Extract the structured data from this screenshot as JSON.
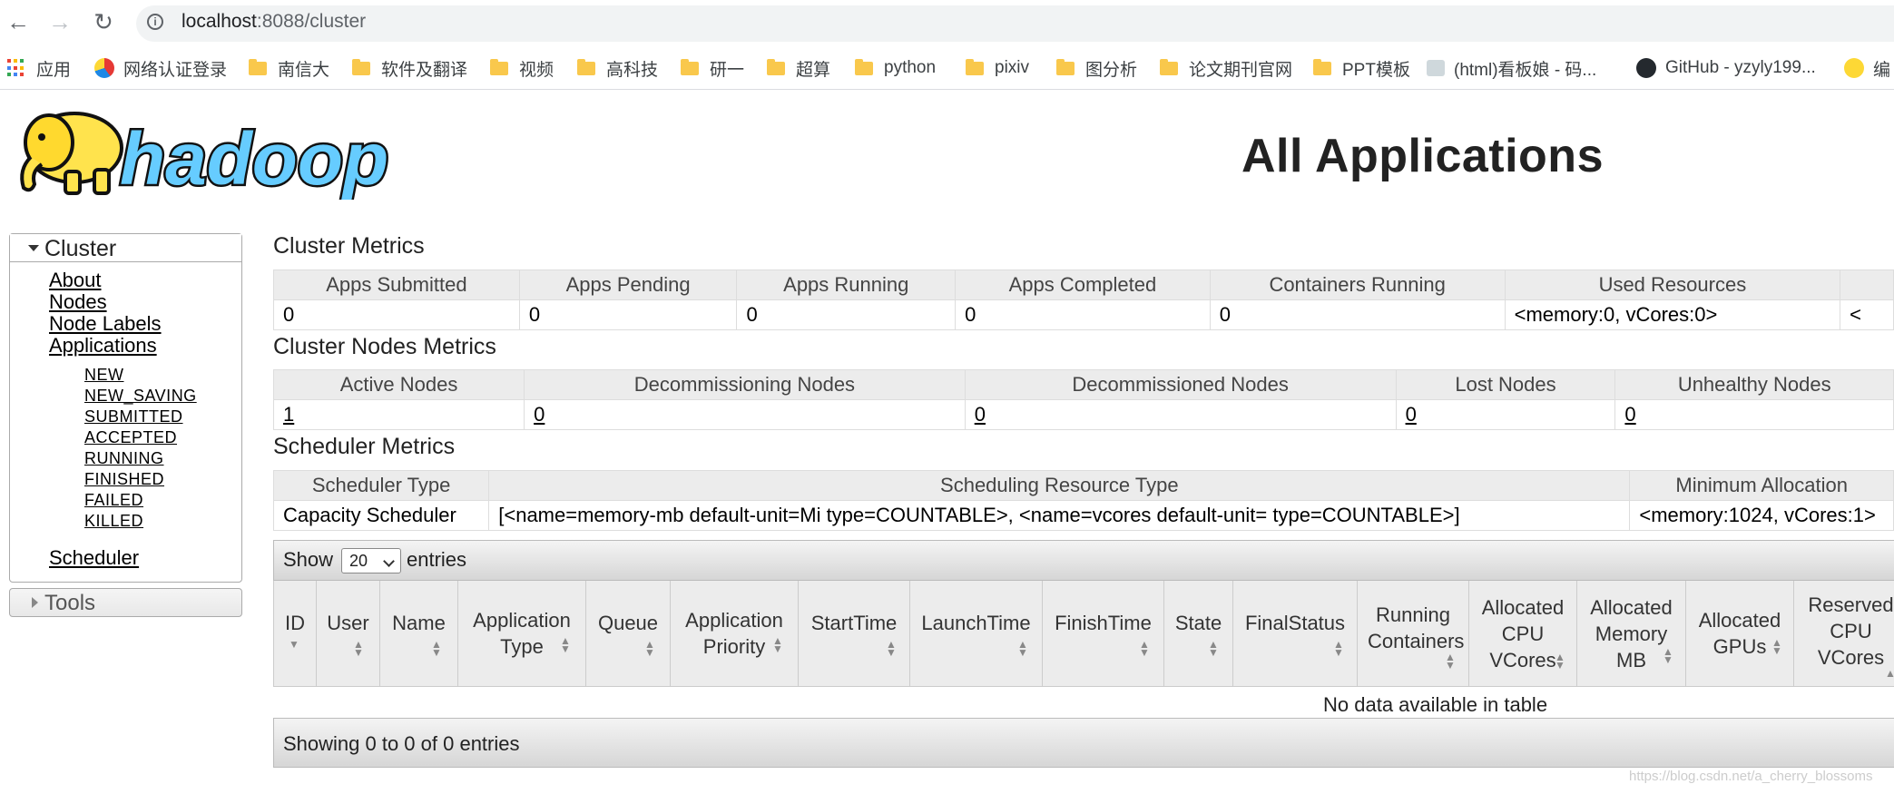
{
  "browser": {
    "url_host": "localhost",
    "url_rest": ":8088/cluster",
    "bookmarks": [
      {
        "label": "应用",
        "icon": "apps-grid-icon"
      },
      {
        "label": "网络认证登录",
        "icon": "site-icon"
      },
      {
        "label": "南信大",
        "icon": "folder-icon"
      },
      {
        "label": "软件及翻译",
        "icon": "folder-icon"
      },
      {
        "label": "视频",
        "icon": "folder-icon"
      },
      {
        "label": "高科技",
        "icon": "folder-icon"
      },
      {
        "label": "研一",
        "icon": "folder-icon"
      },
      {
        "label": "超算",
        "icon": "folder-icon"
      },
      {
        "label": "python",
        "icon": "folder-icon"
      },
      {
        "label": "pixiv",
        "icon": "folder-icon"
      },
      {
        "label": "图分析",
        "icon": "folder-icon"
      },
      {
        "label": "论文期刊官网",
        "icon": "folder-icon"
      },
      {
        "label": "PPT模板",
        "icon": "folder-icon"
      },
      {
        "label": "(html)看板娘 - 码...",
        "icon": "site-icon"
      },
      {
        "label": "GitHub - yzyly199...",
        "icon": "github-icon"
      },
      {
        "label": "编",
        "icon": "site-icon"
      }
    ]
  },
  "page_title": "All Applications",
  "sidebar": {
    "cluster_label": "Cluster",
    "links": [
      "About",
      "Nodes",
      "Node Labels",
      "Applications"
    ],
    "app_states": [
      "NEW",
      "NEW_SAVING",
      "SUBMITTED",
      "ACCEPTED",
      "RUNNING",
      "FINISHED",
      "FAILED",
      "KILLED"
    ],
    "scheduler_label": "Scheduler",
    "tools_label": "Tools"
  },
  "cluster_metrics": {
    "title": "Cluster Metrics",
    "headers": [
      "Apps Submitted",
      "Apps Pending",
      "Apps Running",
      "Apps Completed",
      "Containers Running",
      "Used Resources"
    ],
    "values": [
      "0",
      "0",
      "0",
      "0",
      "0",
      "<memory:0, vCores:0>"
    ],
    "overflow_value": "<"
  },
  "cluster_nodes_metrics": {
    "title": "Cluster Nodes Metrics",
    "headers": [
      "Active Nodes",
      "Decommissioning Nodes",
      "Decommissioned Nodes",
      "Lost Nodes",
      "Unhealthy Nodes"
    ],
    "values": [
      "1",
      "0",
      "0",
      "0",
      "0"
    ]
  },
  "scheduler_metrics": {
    "title": "Scheduler Metrics",
    "headers": [
      "Scheduler Type",
      "Scheduling Resource Type",
      "Minimum Allocation"
    ],
    "values": [
      "Capacity Scheduler",
      "[<name=memory-mb default-unit=Mi type=COUNTABLE>, <name=vcores default-unit= type=COUNTABLE>]",
      "<memory:1024, vCores:1>"
    ]
  },
  "apps_table": {
    "show_label": "Show",
    "page_size": "20",
    "entries_label": "entries",
    "columns": [
      "ID",
      "User",
      "Name",
      "Application Type",
      "Queue",
      "Application Priority",
      "StartTime",
      "LaunchTime",
      "FinishTime",
      "State",
      "FinalStatus",
      "Running Containers",
      "Allocated CPU VCores",
      "Allocated Memory MB",
      "Allocated GPUs",
      "Reserved CPU VCores"
    ],
    "empty_message": "No data available in table",
    "footer": "Showing 0 to 0 of 0 entries"
  },
  "watermark": "https://blog.csdn.net/a_cherry_blossoms"
}
